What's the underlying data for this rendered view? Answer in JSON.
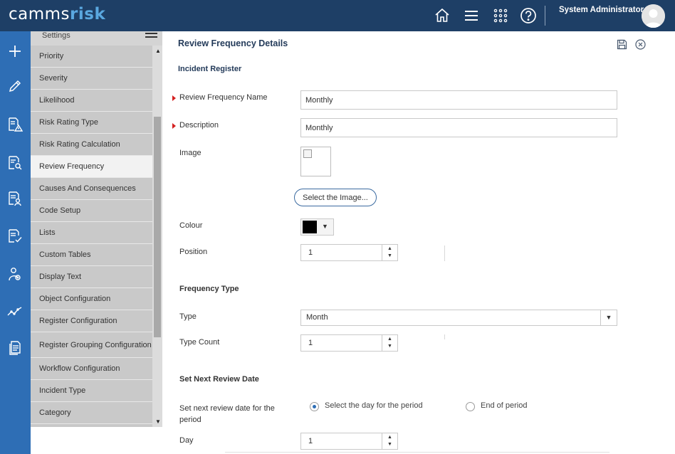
{
  "header": {
    "logo_prefix": "camms",
    "logo_suffix": "risk",
    "user_name": "System Administrator",
    "icons": [
      "home-icon",
      "menu-icon",
      "apps-grid-icon",
      "help-icon"
    ]
  },
  "rail": {
    "icons": [
      "add-icon",
      "edit-pencil-icon",
      "risk-register-icon",
      "search-document-icon",
      "report-icon",
      "checklist-icon",
      "users-icon",
      "trend-chart-icon",
      "documents-icon"
    ]
  },
  "settings_menu": {
    "title": "Settings",
    "items": [
      {
        "label": "Priority"
      },
      {
        "label": "Severity"
      },
      {
        "label": "Likelihood"
      },
      {
        "label": "Risk Rating Type"
      },
      {
        "label": "Risk Rating Calculation"
      },
      {
        "label": "Review Frequency"
      },
      {
        "label": "Causes And Consequences"
      },
      {
        "label": "Code Setup"
      },
      {
        "label": "Lists"
      },
      {
        "label": "Custom Tables"
      },
      {
        "label": "Display Text"
      },
      {
        "label": "Object Configuration"
      },
      {
        "label": "Register Configuration"
      },
      {
        "label": "Register Grouping Configuration"
      },
      {
        "label": "Workflow Configuration"
      },
      {
        "label": "Incident Type"
      },
      {
        "label": "Category"
      }
    ],
    "active_item": "Review Frequency"
  },
  "form": {
    "title": "Review Frequency Details",
    "register": "Incident Register",
    "name_label": "Review Frequency Name",
    "name_value": "Monthly",
    "description_label": "Description",
    "description_value": "Monthly",
    "image_label": "Image",
    "select_image_label": "Select the Image...",
    "colour_label": "Colour",
    "colour_value": "#000000",
    "position_label": "Position",
    "position_value": "1",
    "frequency_type_heading": "Frequency Type",
    "type_label": "Type",
    "type_value": "Month",
    "type_count_label": "Type Count",
    "type_count_value": "1",
    "next_review_heading": "Set Next Review Date",
    "next_review_label": "Set next review date for the period",
    "radio_option_1": "Select the day for the period",
    "radio_option_2": "End of period",
    "radio_selected": "Select the day for the period",
    "day_label": "Day",
    "day_value": "1"
  },
  "colors": {
    "header_bg": "#1e3f66",
    "rail_bg": "#2e6eb5",
    "logo_accent": "#5aa8e0",
    "required_marker": "#d42020"
  }
}
